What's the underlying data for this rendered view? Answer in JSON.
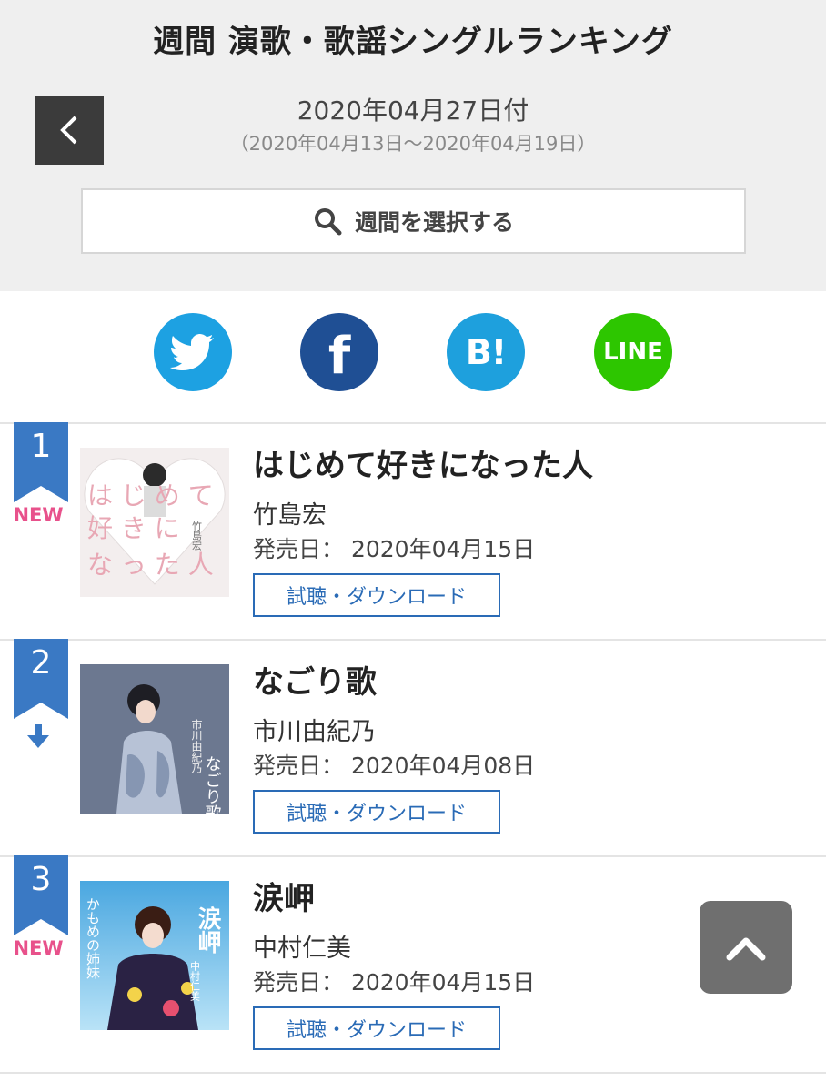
{
  "header": {
    "title": "週間 演歌・歌謡シングルランキング",
    "date": "2020年04月27日付",
    "range": "（2020年04月13日〜2020年04月19日）",
    "week_select_label": "週間を選択する"
  },
  "share": {
    "line_label": "LINE",
    "hatena_label": "B!",
    "facebook_label": "f"
  },
  "rankings": [
    {
      "rank": "1",
      "status": "NEW",
      "title": "はじめて好きになった人",
      "artist": "竹島宏",
      "release": "発売日： 2020年04月15日",
      "button": "試聴・ダウンロード",
      "jacket_text": "はじめて好きになった人",
      "jacket_artist": "竹島宏"
    },
    {
      "rank": "2",
      "status": "down",
      "title": "なごり歌",
      "artist": "市川由紀乃",
      "release": "発売日： 2020年04月08日",
      "button": "試聴・ダウンロード",
      "jacket_text": "なごり歌",
      "jacket_artist": "市川由紀乃"
    },
    {
      "rank": "3",
      "status": "NEW",
      "title": "涙岬",
      "artist": "中村仁美",
      "release": "発売日： 2020年04月15日",
      "button": "試聴・ダウンロード",
      "jacket_text": "涙岬",
      "jacket_artist": "中村仁美",
      "jacket_sub": "かもめの姉妹"
    }
  ],
  "colors": {
    "accent_blue": "#2a6bb6",
    "new_pink": "#e8518b",
    "badge_blue": "#3a79c4"
  }
}
